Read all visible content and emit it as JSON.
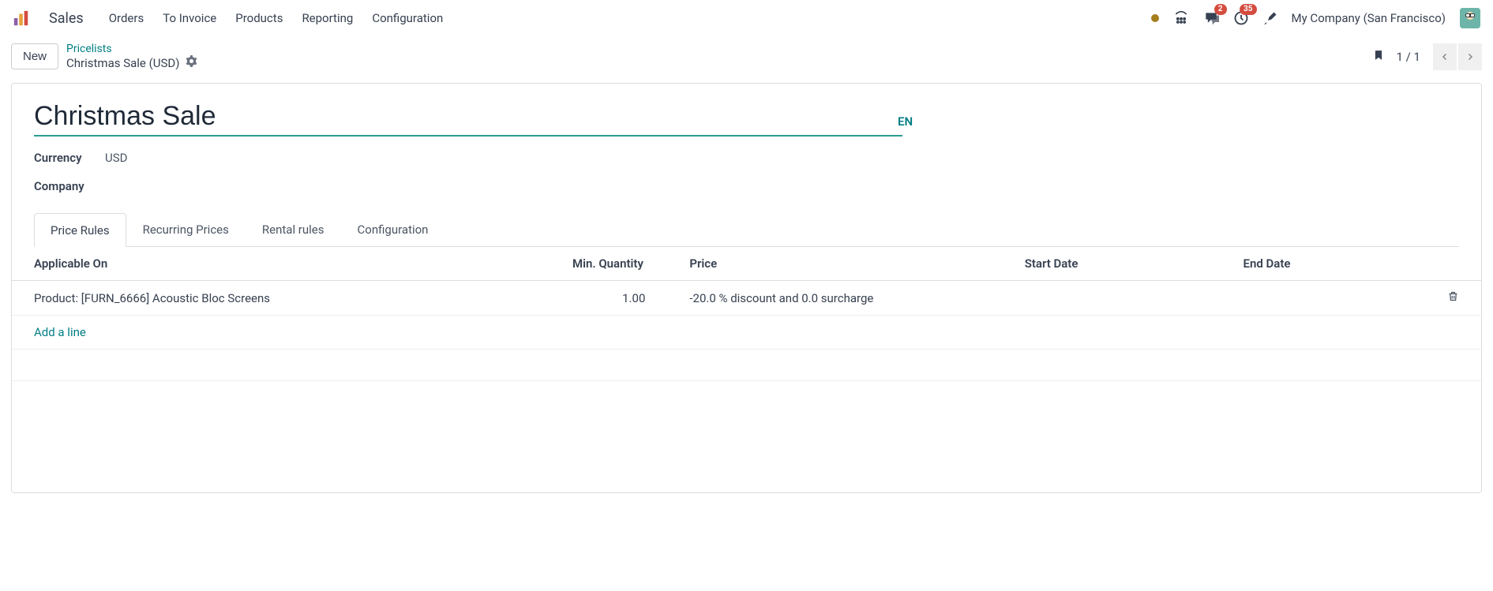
{
  "nav": {
    "app": "Sales",
    "items": [
      "Orders",
      "To Invoice",
      "Products",
      "Reporting",
      "Configuration"
    ],
    "company": "My Company (San Francisco)",
    "chat_badge": "2",
    "clock_badge": "35"
  },
  "control": {
    "new_label": "New",
    "bc_parent": "Pricelists",
    "bc_current": "Christmas Sale (USD)",
    "pager": "1 / 1"
  },
  "form": {
    "title": "Christmas Sale",
    "lang": "EN",
    "currency_label": "Currency",
    "currency_value": "USD",
    "company_label": "Company",
    "company_value": ""
  },
  "tabs": [
    "Price Rules",
    "Recurring Prices",
    "Rental rules",
    "Configuration"
  ],
  "table": {
    "headers": {
      "applicable": "Applicable On",
      "min_qty": "Min. Quantity",
      "price": "Price",
      "start": "Start Date",
      "end": "End Date"
    },
    "rows": [
      {
        "applicable": "Product: [FURN_6666] Acoustic Bloc Screens",
        "min_qty": "1.00",
        "price": "-20.0 % discount and 0.0 surcharge",
        "start": "",
        "end": ""
      }
    ],
    "add_line": "Add a line"
  }
}
